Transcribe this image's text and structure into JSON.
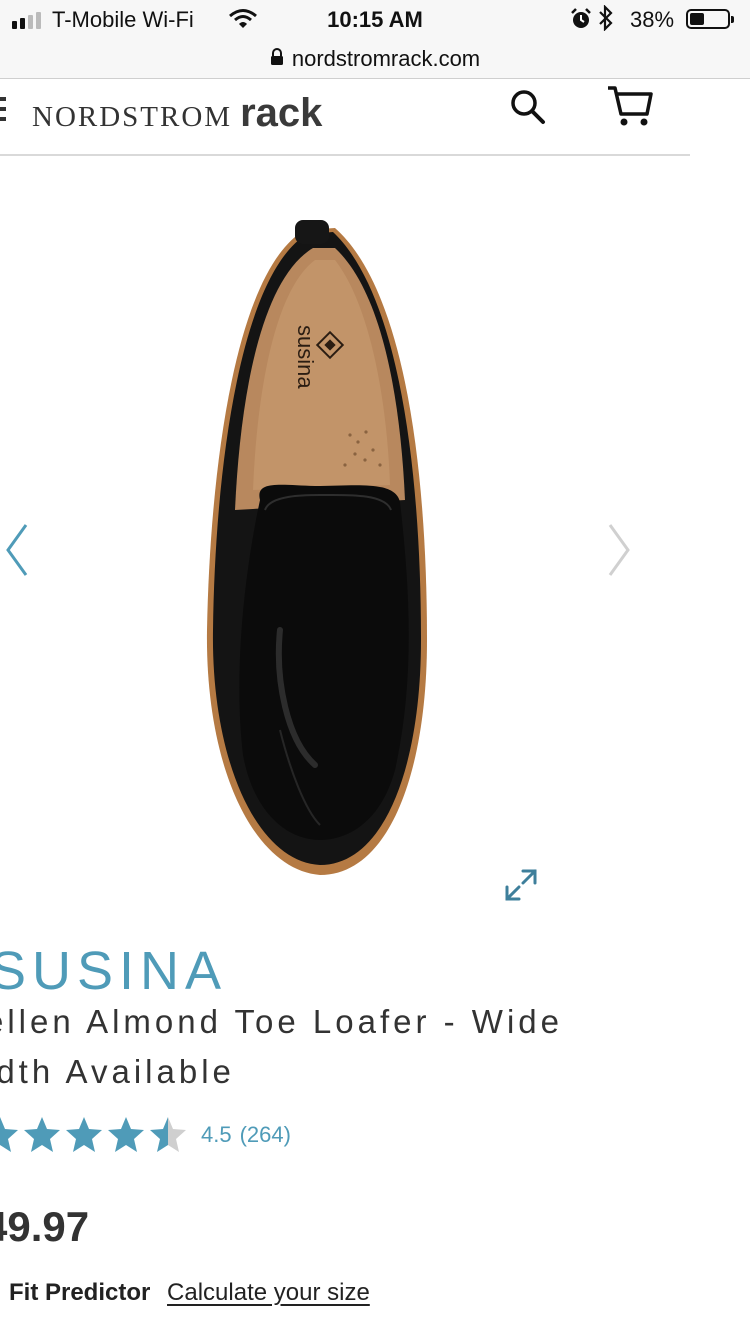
{
  "status_bar": {
    "carrier": "T-Mobile Wi-Fi",
    "time": "10:15 AM",
    "battery_percent": "38%",
    "battery_level": 0.38,
    "icons": [
      "cellular-signal-icon",
      "wifi-icon",
      "alarm-icon",
      "bluetooth-icon",
      "battery-icon"
    ]
  },
  "browser": {
    "url": "nordstromrack.com"
  },
  "header": {
    "logo_word1": "NORDSTROM",
    "logo_word2": "rack",
    "icons": [
      "menu-icon",
      "search-icon",
      "cart-icon"
    ]
  },
  "gallery": {
    "shoe_insole_brand": "susina",
    "icons": [
      "chevron-left-icon",
      "chevron-right-icon",
      "expand-icon"
    ]
  },
  "product": {
    "brand": "SUSINA",
    "name": "ellen Almond Toe Loafer - Wide idth Available",
    "name_line1": "ellen Almond Toe Loafer - Wide",
    "name_line2": "idth Available",
    "rating_value": 4.5,
    "rating": "4.5",
    "review_count": "(264)",
    "price": "49.97",
    "fit_predictor_label": "Fit Predictor",
    "fit_predictor_link": "Calculate your size"
  },
  "colors": {
    "accent": "#4f9bb8",
    "text": "#333333",
    "star_empty": "#cfcfcf"
  }
}
